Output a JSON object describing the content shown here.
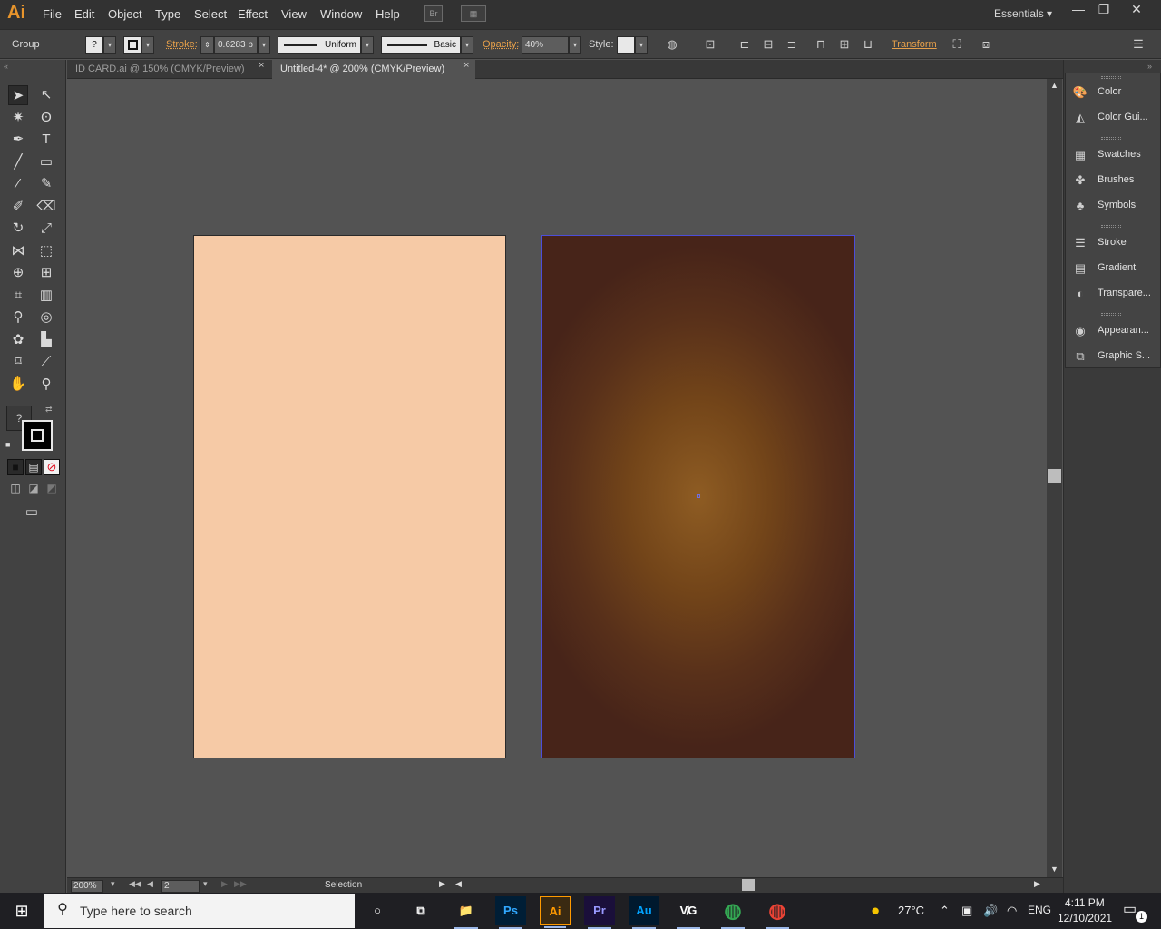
{
  "app": {
    "logo": "Ai",
    "name": "Adobe Illustrator"
  },
  "menu": [
    "File",
    "Edit",
    "Object",
    "Type",
    "Select",
    "Effect",
    "View",
    "Window",
    "Help"
  ],
  "menubar_buttons": {
    "bridge": "Br",
    "arrange": "▦"
  },
  "workspace": {
    "label": "Essentials",
    "caret": "▾"
  },
  "window_controls": {
    "minimize": "—",
    "restore": "❐",
    "close": "✕"
  },
  "controlbar": {
    "selection_type": "Group",
    "fill_value": "?",
    "stroke_label": "Stroke:",
    "stroke_weight": "0.6283 p",
    "variable_width": "Uniform",
    "brush_definition": "Basic",
    "opacity_label": "Opacity:",
    "opacity_value": "40%",
    "style_label": "Style:",
    "transform_link": "Transform"
  },
  "tabs": [
    {
      "title": "ID CARD.ai @ 150% (CMYK/Preview)",
      "close": "×",
      "active": false
    },
    {
      "title": "Untitled-4* @ 200% (CMYK/Preview)",
      "close": "×",
      "active": true
    }
  ],
  "tools": [
    {
      "name": "selection-tool",
      "glyph": "➤"
    },
    {
      "name": "direct-selection-tool",
      "glyph": "↖"
    },
    {
      "name": "magic-wand-tool",
      "glyph": "✷"
    },
    {
      "name": "lasso-tool",
      "glyph": "ʘ"
    },
    {
      "name": "pen-tool",
      "glyph": "✒"
    },
    {
      "name": "type-tool",
      "glyph": "T"
    },
    {
      "name": "line-tool",
      "glyph": "╱"
    },
    {
      "name": "rectangle-tool",
      "glyph": "▭"
    },
    {
      "name": "paintbrush-tool",
      "glyph": "⁄"
    },
    {
      "name": "pencil-tool",
      "glyph": "✎"
    },
    {
      "name": "blob-brush-tool",
      "glyph": "✐"
    },
    {
      "name": "eraser-tool",
      "glyph": "⌫"
    },
    {
      "name": "rotate-tool",
      "glyph": "↻"
    },
    {
      "name": "scale-tool",
      "glyph": "⤢"
    },
    {
      "name": "width-tool",
      "glyph": "⋈"
    },
    {
      "name": "free-transform-tool",
      "glyph": "⬚"
    },
    {
      "name": "shape-builder-tool",
      "glyph": "⊕"
    },
    {
      "name": "perspective-grid-tool",
      "glyph": "⊞"
    },
    {
      "name": "mesh-tool",
      "glyph": "⌗"
    },
    {
      "name": "gradient-tool",
      "glyph": "▥"
    },
    {
      "name": "eyedropper-tool",
      "glyph": "⚲"
    },
    {
      "name": "blend-tool",
      "glyph": "◎"
    },
    {
      "name": "symbol-sprayer-tool",
      "glyph": "✿"
    },
    {
      "name": "column-graph-tool",
      "glyph": "▙"
    },
    {
      "name": "artboard-tool",
      "glyph": "⌑"
    },
    {
      "name": "slice-tool",
      "glyph": "⟋"
    },
    {
      "name": "hand-tool",
      "glyph": "✋"
    },
    {
      "name": "zoom-tool",
      "glyph": "⚲"
    }
  ],
  "fill_stroke": {
    "fill_value": "?",
    "swap": "⇄",
    "default": "■"
  },
  "color_modes": {
    "color": "■",
    "gradient": "▤",
    "none": "⊘"
  },
  "draw_modes": {
    "normal": "◫",
    "behind": "◪",
    "inside": "◩"
  },
  "screen_mode": "▭",
  "artboards": [
    {
      "fill": "#f6caa6"
    },
    {
      "fill_center": "#8e5c23",
      "fill_edge": "#472419",
      "selection_color": "#4d4ed8"
    }
  ],
  "status": {
    "zoom": "200%",
    "artboard_number": "2",
    "current_tool": "Selection",
    "nav_first": "◀◀",
    "nav_prev": "◀",
    "nav_next": "▶",
    "nav_last": "▶▶"
  },
  "right_panels": [
    {
      "label": "Color",
      "icon": "palette-icon",
      "glyph": "🎨"
    },
    {
      "label": "Color Gui...",
      "icon": "color-guide-icon",
      "glyph": "◭"
    },
    {
      "label": "Swatches",
      "icon": "swatches-icon",
      "glyph": "▦"
    },
    {
      "label": "Brushes",
      "icon": "brushes-icon",
      "glyph": "✤"
    },
    {
      "label": "Symbols",
      "icon": "symbols-icon",
      "glyph": "♣"
    },
    {
      "label": "Stroke",
      "icon": "stroke-icon",
      "glyph": "☰"
    },
    {
      "label": "Gradient",
      "icon": "gradient-icon",
      "glyph": "▤"
    },
    {
      "label": "Transpare...",
      "icon": "transparency-icon",
      "glyph": "◐"
    },
    {
      "label": "Appearan...",
      "icon": "appearance-icon",
      "glyph": "◉"
    },
    {
      "label": "Graphic S...",
      "icon": "graphic-styles-icon",
      "glyph": "⧉"
    }
  ],
  "taskbar": {
    "search_placeholder": "Type here to search",
    "apps": [
      {
        "name": "cortana",
        "glyph": "○",
        "color": "#ffffff"
      },
      {
        "name": "task-view",
        "glyph": "⧉",
        "color": "#ffffff"
      },
      {
        "name": "file-explorer",
        "glyph": "📁",
        "color": "#f2c14e"
      },
      {
        "name": "photoshop",
        "glyph": "Ps",
        "color": "#31a8ff"
      },
      {
        "name": "illustrator",
        "glyph": "Ai",
        "color": "#ff9a00"
      },
      {
        "name": "premiere",
        "glyph": "Pr",
        "color": "#9999ff"
      },
      {
        "name": "audition",
        "glyph": "Au",
        "color": "#00a3ff"
      },
      {
        "name": "vegas",
        "glyph": "V̸G",
        "color": "#ffffff"
      },
      {
        "name": "chrome-m",
        "glyph": "◍",
        "color": "#34a853"
      },
      {
        "name": "chrome",
        "glyph": "◍",
        "color": "#ea4335"
      }
    ],
    "weather": "27°C",
    "language": "ENG",
    "time": "4:11 PM",
    "date": "12/10/2021",
    "notifications": "1"
  }
}
